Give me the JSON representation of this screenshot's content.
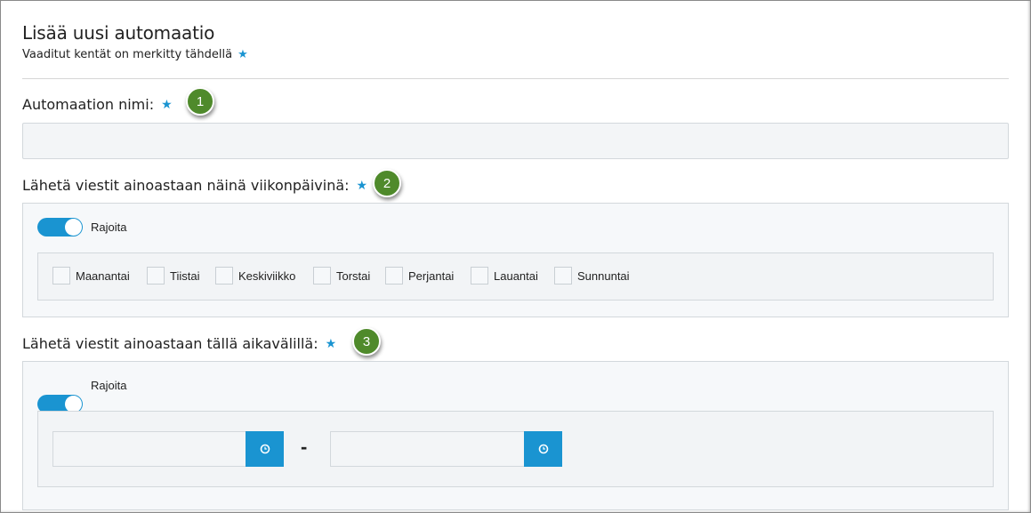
{
  "header": {
    "title": "Lisää uusi automaatio",
    "required_note": "Vaaditut kentät on merkitty tähdellä"
  },
  "fields": {
    "name": {
      "label": "Automaation nimi:",
      "badge": "1",
      "value": "",
      "placeholder": ""
    },
    "weekdays": {
      "label": "Lähetä viestit ainoastaan näinä viikonpäivinä:",
      "badge": "2",
      "toggle_label": "Rajoita",
      "toggle_on": true,
      "days": [
        "Maanantai",
        "Tiistai",
        "Keskiviikko",
        "Torstai",
        "Perjantai",
        "Lauantai",
        "Sunnuntai"
      ]
    },
    "timerange": {
      "label": "Lähetä viestit ainoastaan tällä aikavälillä:",
      "badge": "3",
      "toggle_label": "Rajoita",
      "toggle_on": true,
      "start_value": "",
      "end_value": "",
      "separator": "-"
    }
  },
  "icons": {
    "required": "star-icon",
    "time": "clock-icon"
  },
  "colors": {
    "accent": "#1a94d1",
    "badge": "#4f8a2b",
    "field_bg": "#f3f5f7",
    "border": "#d3d8dc"
  }
}
